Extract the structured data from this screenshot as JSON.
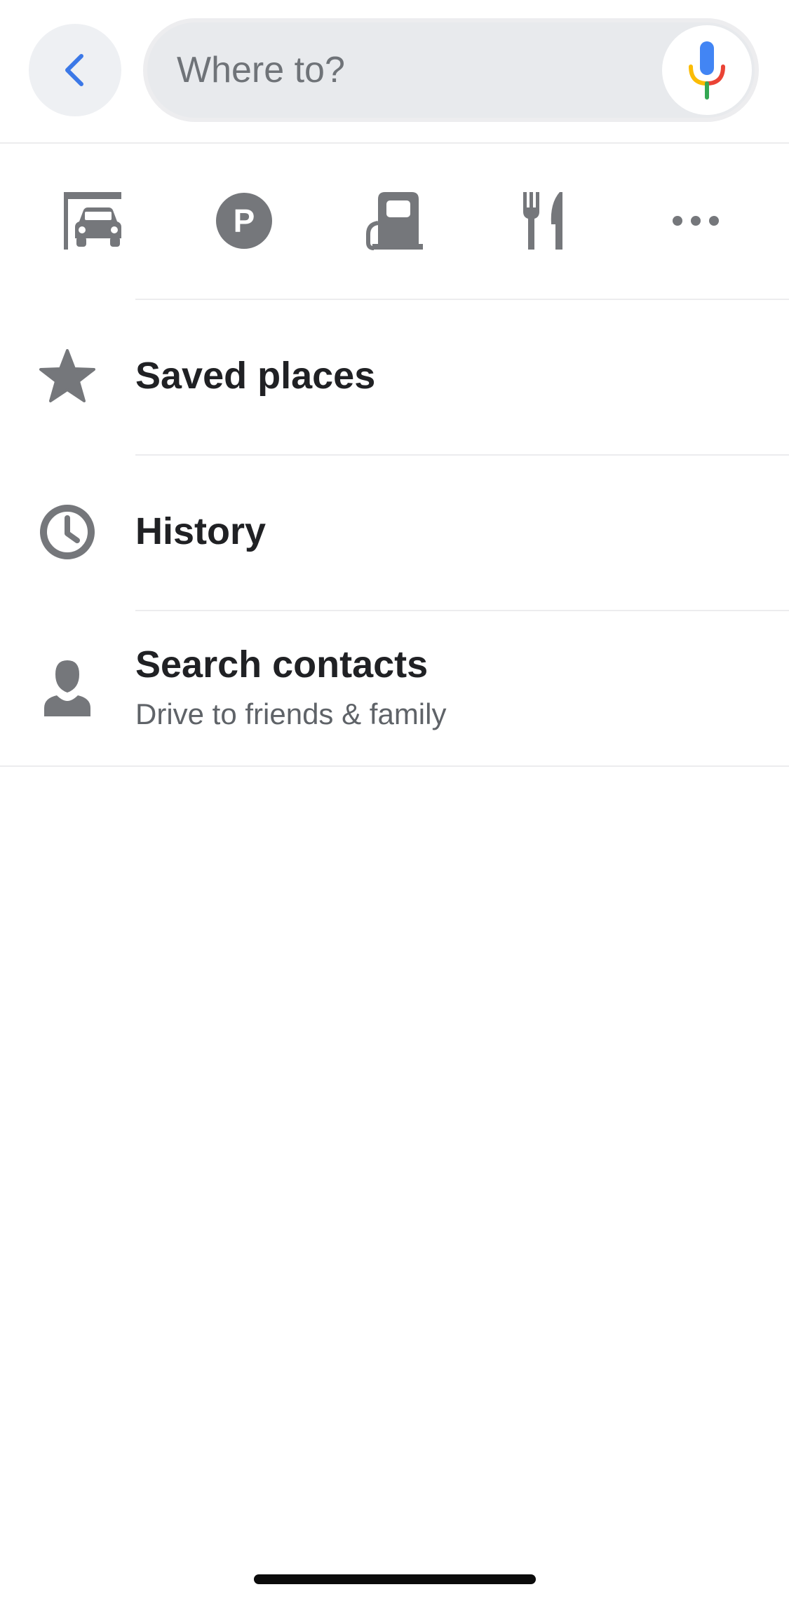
{
  "search": {
    "placeholder": "Where to?",
    "value": ""
  },
  "categories": [
    {
      "icon": "car-wash-icon"
    },
    {
      "icon": "parking-icon",
      "glyph": "P"
    },
    {
      "icon": "gas-station-icon"
    },
    {
      "icon": "restaurant-icon"
    },
    {
      "icon": "more-icon"
    }
  ],
  "list": {
    "saved": {
      "title": "Saved places",
      "icon": "star-icon"
    },
    "history": {
      "title": "History",
      "icon": "clock-icon"
    },
    "contacts": {
      "title": "Search contacts",
      "subtitle": "Drive to friends & family",
      "icon": "contact-icon"
    }
  },
  "colors": {
    "icon_gray": "#75777b",
    "accent_blue": "#3b78e7",
    "mic_blue": "#4285f4",
    "mic_red": "#ea4335",
    "mic_yellow": "#fbbc05",
    "mic_green": "#34a853"
  }
}
